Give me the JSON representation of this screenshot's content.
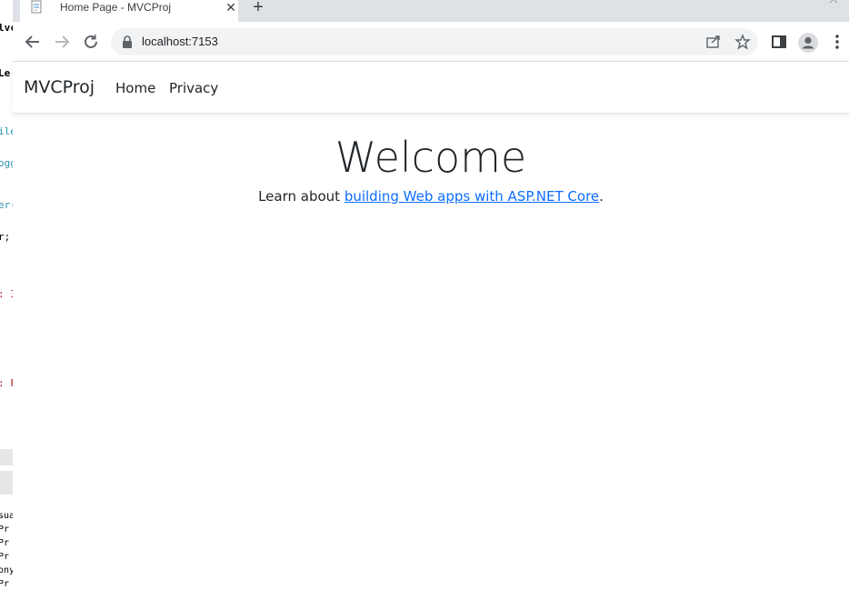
{
  "browser": {
    "tab": {
      "title": "Home Page - MVCProj",
      "close_glyph": "✕"
    },
    "new_tab_glyph": "+",
    "omnibox": {
      "url": "localhost:7153"
    },
    "icons": {
      "back": "arrow-left-icon",
      "forward": "arrow-right-icon",
      "reload": "reload-icon",
      "lock": "lock-icon",
      "share": "share-icon",
      "bookmark": "star-icon",
      "side_panel": "side-panel-icon",
      "profile": "profile-icon",
      "menu": "kebab-menu-icon"
    }
  },
  "page": {
    "navbar": {
      "brand": "MVCProj",
      "links": [
        "Home",
        "Privacy"
      ]
    },
    "heading": "Welcome",
    "learn": {
      "prefix": "Learn about ",
      "link_text": "building Web apps with ASP.NET Core",
      "suffix": "."
    }
  },
  "background_editor": {
    "fragments": [
      "lvc",
      "Le",
      "ile",
      "ogg",
      "er(",
      "r;",
      ": I",
      ": F",
      "sua",
      "Pr",
      "Pr",
      "Pr",
      "ony",
      "Pr"
    ]
  },
  "colors": {
    "link": "#0d6efd",
    "tabstrip": "#dee1e6",
    "omnibox": "#f1f3f4",
    "text": "#212529"
  }
}
